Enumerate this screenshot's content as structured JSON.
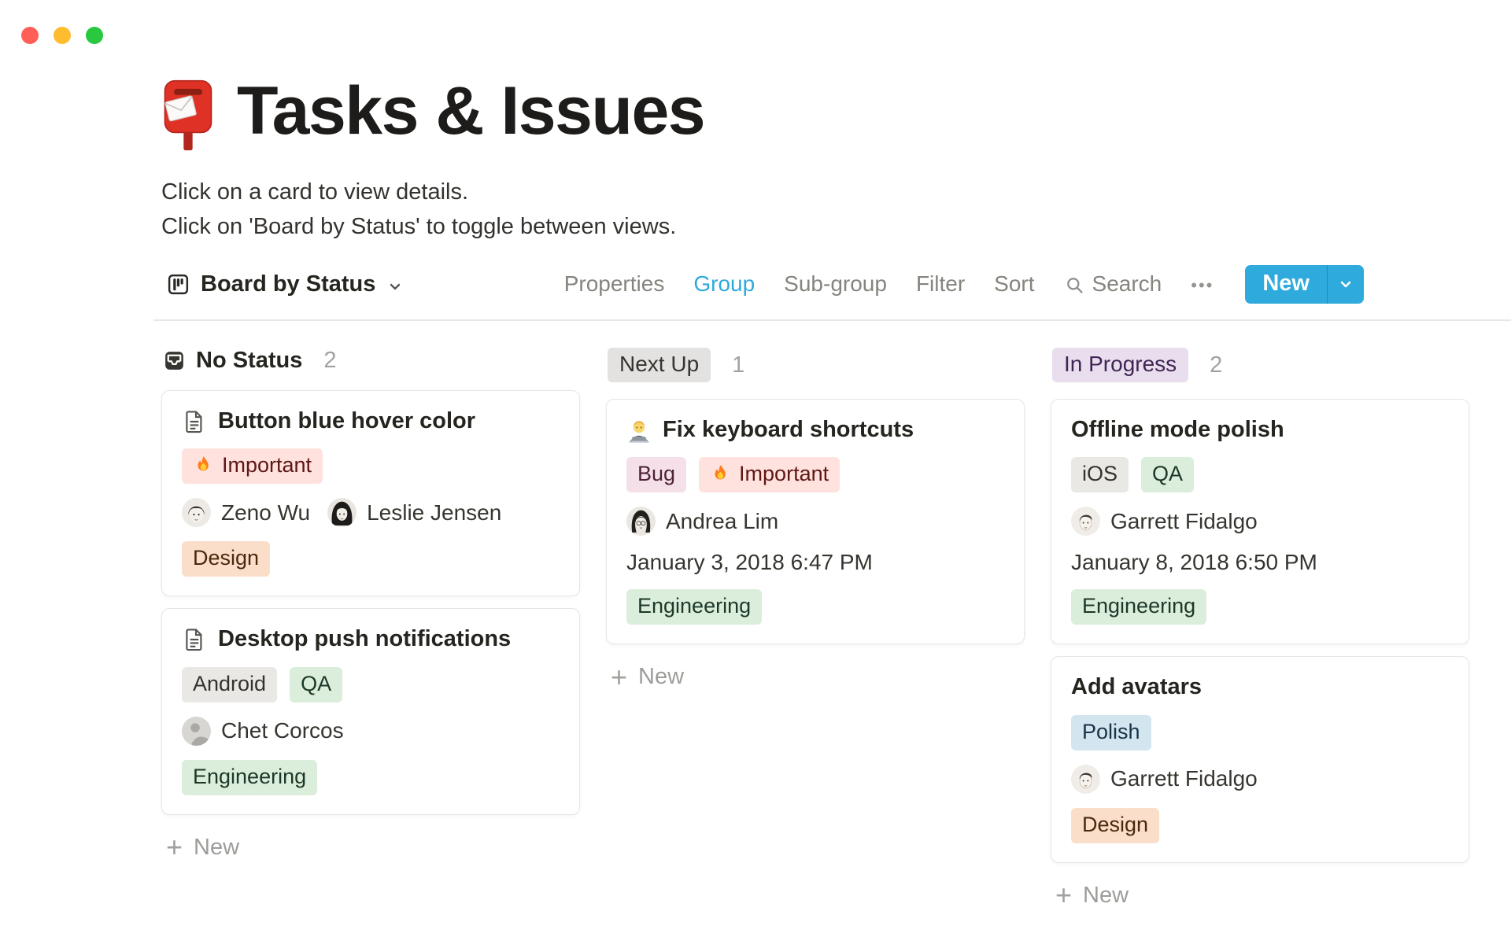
{
  "colors": {
    "accent_blue": "#2EAADC",
    "traffic_red": "#FF5F57",
    "traffic_yellow": "#FEBC2E",
    "traffic_green": "#28C840",
    "tags": {
      "gray": {
        "bg": "#E9E8E5",
        "text": "#34322E"
      },
      "header_gray": {
        "bg": "#E3E2E0",
        "text": "#37352F"
      },
      "green": {
        "bg": "#DBEDDB",
        "text": "#1C3829"
      },
      "orange": {
        "bg": "#FADEC9",
        "text": "#49290E"
      },
      "red": {
        "bg": "#FFE2DD",
        "text": "#5D1715"
      },
      "pink": {
        "bg": "#F5E0E9",
        "text": "#4C2337"
      },
      "purple": {
        "bg": "#E8DEEE",
        "text": "#412454"
      },
      "blue": {
        "bg": "#D3E5EF",
        "text": "#183347"
      }
    }
  },
  "page": {
    "icon": "postbox-emoji",
    "title": "Tasks & Issues",
    "description_line1": "Click on a card to view details.",
    "description_line2": "Click on 'Board by Status' to toggle between views."
  },
  "toolbar": {
    "view_icon": "board-view-icon",
    "view_label": "Board by Status",
    "items": [
      "Properties",
      "Group",
      "Sub-group",
      "Filter",
      "Sort"
    ],
    "active_item": "Group",
    "search_label": "Search",
    "more_label": "•••",
    "new_label": "New"
  },
  "board": {
    "columns": [
      {
        "name": "No Status",
        "count": "2",
        "header_style": "plain",
        "header_icon": "inbox-icon",
        "add_label": "New",
        "cards": [
          {
            "icon": "page-icon",
            "title": "Button blue hover color",
            "tags1": [
              {
                "label": "Important",
                "color": "red",
                "icon": "fire-icon"
              }
            ],
            "people": [
              {
                "name": "Zeno Wu"
              },
              {
                "name": "Leslie Jensen"
              }
            ],
            "tags2": [
              {
                "label": "Design",
                "color": "orange"
              }
            ]
          },
          {
            "icon": "page-icon",
            "title": "Desktop push notifications",
            "tags1": [
              {
                "label": "Android",
                "color": "gray"
              },
              {
                "label": "QA",
                "color": "green"
              }
            ],
            "people": [
              {
                "name": "Chet Corcos"
              }
            ],
            "tags2": [
              {
                "label": "Engineering",
                "color": "green"
              }
            ]
          }
        ]
      },
      {
        "name": "Next Up",
        "count": "1",
        "header_style": "gray-pill",
        "add_label": "New",
        "cards": [
          {
            "icon": "technologist-emoji",
            "title": "Fix keyboard shortcuts",
            "tags1": [
              {
                "label": "Bug",
                "color": "pink"
              },
              {
                "label": "Important",
                "color": "red",
                "icon": "fire-icon"
              }
            ],
            "people": [
              {
                "name": "Andrea Lim"
              }
            ],
            "date": "January 3, 2018 6:47 PM",
            "tags2": [
              {
                "label": "Engineering",
                "color": "green"
              }
            ]
          }
        ]
      },
      {
        "name": "In Progress",
        "count": "2",
        "header_style": "purple-pill",
        "add_label": "New",
        "cards": [
          {
            "title": "Offline mode polish",
            "tags1": [
              {
                "label": "iOS",
                "color": "gray"
              },
              {
                "label": "QA",
                "color": "green"
              }
            ],
            "people": [
              {
                "name": "Garrett Fidalgo"
              }
            ],
            "date": "January 8, 2018 6:50 PM",
            "tags2": [
              {
                "label": "Engineering",
                "color": "green"
              }
            ]
          },
          {
            "title": "Add avatars",
            "tags1": [
              {
                "label": "Polish",
                "color": "blue"
              }
            ],
            "people": [
              {
                "name": "Garrett Fidalgo"
              }
            ],
            "tags2": [
              {
                "label": "Design",
                "color": "orange"
              }
            ]
          }
        ]
      }
    ]
  }
}
